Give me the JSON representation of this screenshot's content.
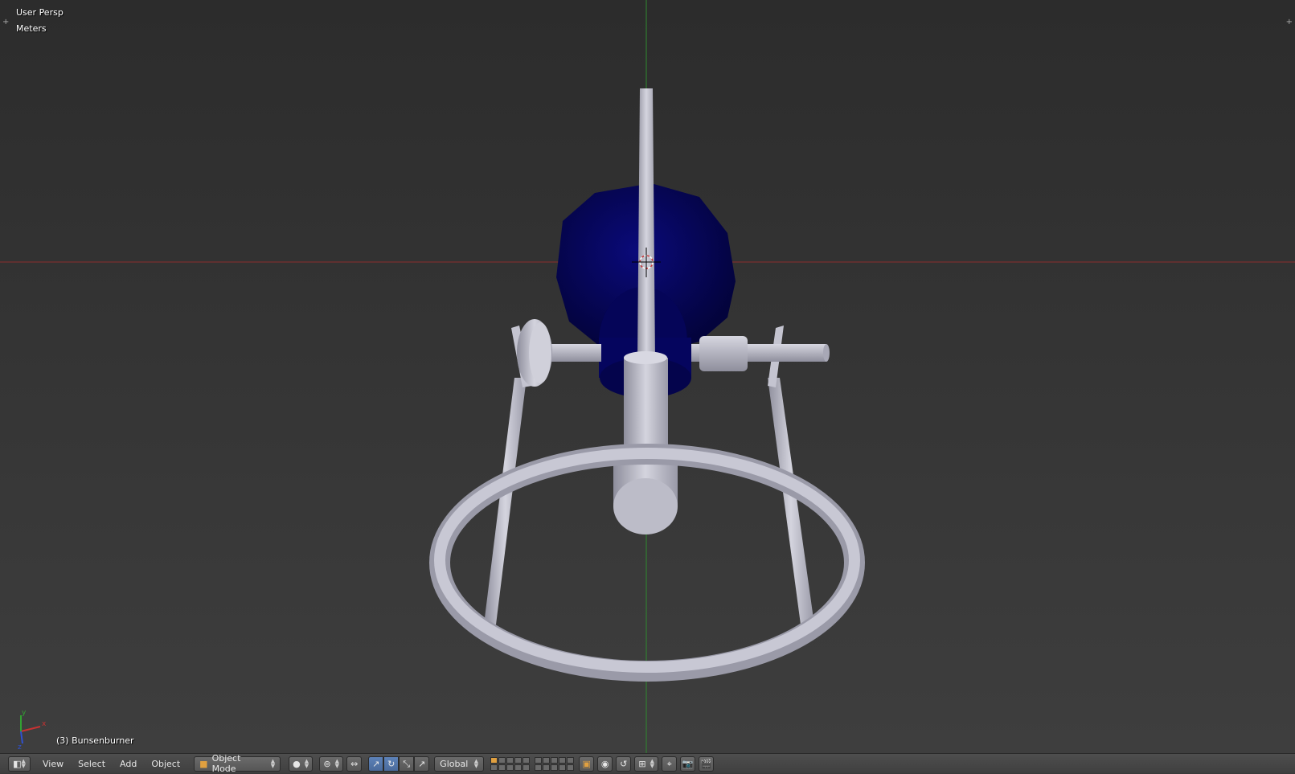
{
  "viewport": {
    "view_name": "User Persp",
    "units": "Meters",
    "object_info": "(3) Bunsenburner",
    "axis_labels": {
      "x": "x",
      "y": "y",
      "z": "z"
    }
  },
  "header": {
    "editor_type_icon": "view3d-icon",
    "menus": [
      "View",
      "Select",
      "Add",
      "Object"
    ],
    "mode": "Object Mode",
    "viewport_shading_icon": "solid-sphere-icon",
    "pivot_icon": "pivot-icon",
    "manipulator_icon": "manipulator-icon",
    "transform_orientation": "Global",
    "icons": [
      "translate-icon",
      "rotate-icon",
      "scale-icon",
      "layers-grid",
      "lock-icon",
      "snap-icon",
      "render-icon"
    ]
  },
  "colors": {
    "viewport_bg": "#393939",
    "x_axis": "#c83232",
    "y_axis": "#32a032",
    "metal": "#b8b8c4",
    "blue_part": "#0a0a6e",
    "selected_accent": "#5680c2"
  }
}
